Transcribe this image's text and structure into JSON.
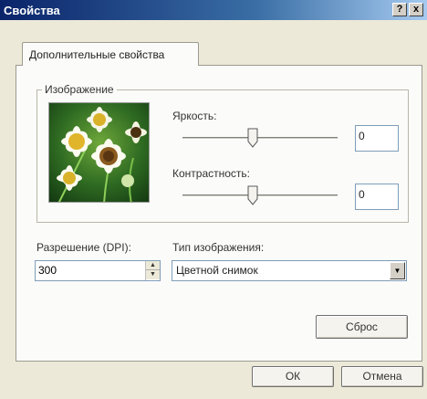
{
  "window": {
    "title": "Свойства",
    "help_glyph": "?",
    "close_glyph": "x"
  },
  "tabs": [
    {
      "label": "Дополнительные свойства",
      "selected": true
    }
  ],
  "image_group": {
    "label": "Изображение",
    "brightness": {
      "label": "Яркость:",
      "value": "0",
      "slider_fraction": 0.45
    },
    "contrast": {
      "label": "Контрастность:",
      "value": "0",
      "slider_fraction": 0.45
    }
  },
  "resolution": {
    "label": "Разрешение (DPI):",
    "value": "300"
  },
  "image_type": {
    "label": "Тип изображения:",
    "selected": "Цветной снимок"
  },
  "buttons": {
    "reset": "Сброс",
    "ok": "ОК",
    "cancel": "Отмена"
  },
  "colors": {
    "titlebar_start": "#0a246a",
    "dialog_bg": "#ece9d8",
    "panel_bg": "#fbfbf9"
  }
}
